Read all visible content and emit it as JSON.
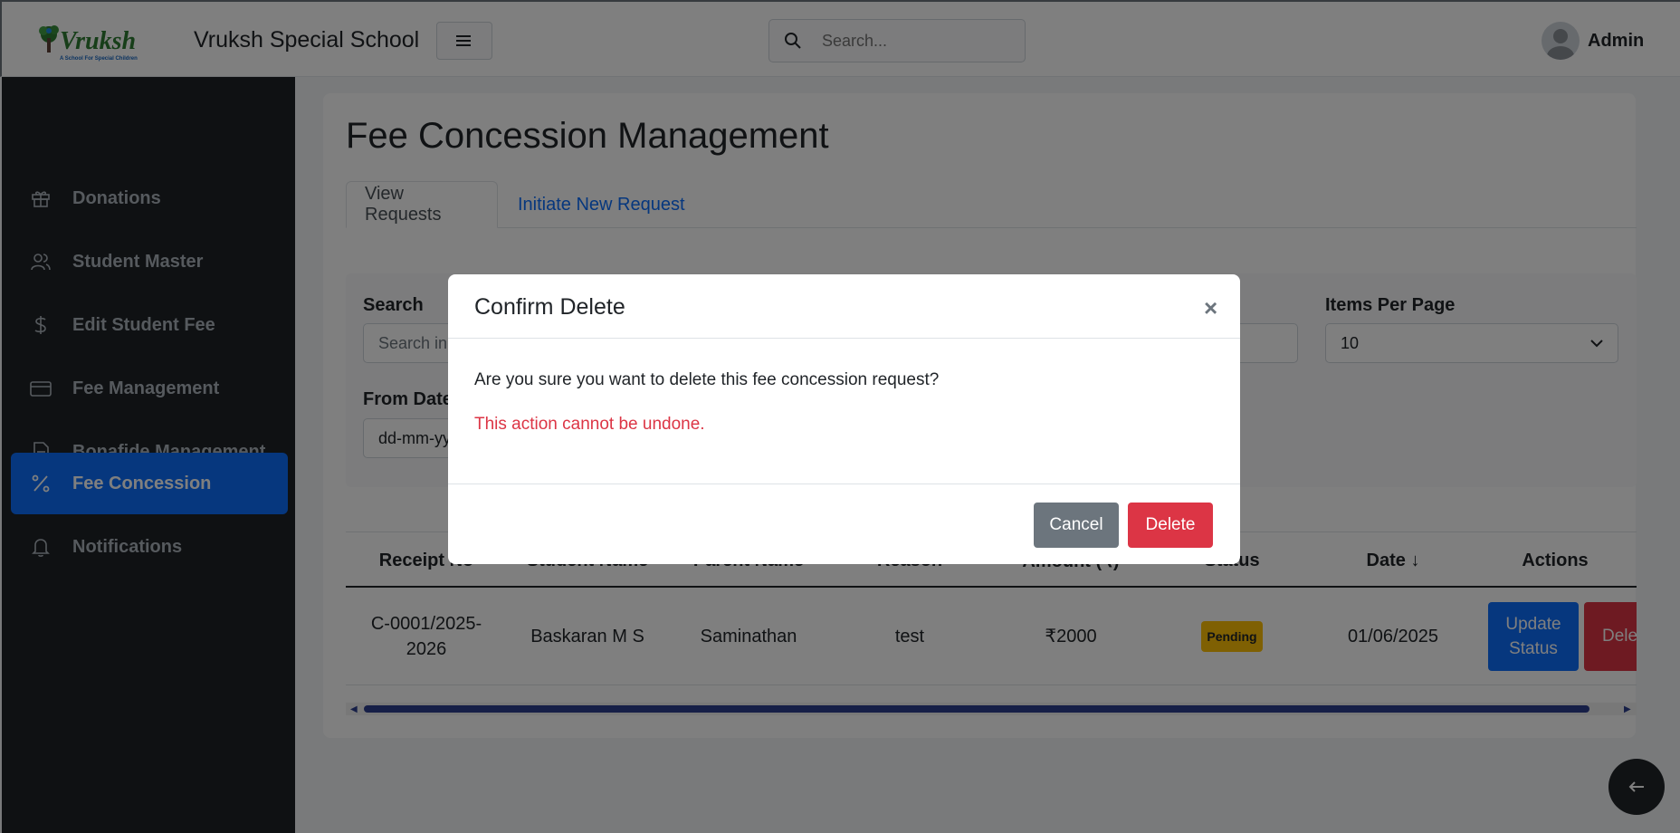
{
  "header": {
    "brand": "Vruksh Special School",
    "logo_text": "Vruksh",
    "logo_tagline": "A School For Special Children",
    "search_placeholder": "Search...",
    "user": "Admin"
  },
  "sidebar": {
    "items": [
      {
        "label": "Donations",
        "icon": "gift-icon"
      },
      {
        "label": "Student Master",
        "icon": "users-icon"
      },
      {
        "label": "Edit Student Fee",
        "icon": "dollar-icon"
      },
      {
        "label": "Fee Management",
        "icon": "credit-card-icon"
      },
      {
        "label": "Bonafide Management",
        "icon": "document-icon"
      },
      {
        "label": "Fee Concession",
        "icon": "percent-icon",
        "active": true
      },
      {
        "label": "Notifications",
        "icon": "bell-icon"
      }
    ]
  },
  "main": {
    "title": "Fee Concession Management",
    "tabs": [
      {
        "label": "View Requests",
        "active": true
      },
      {
        "label": "Initiate New Request"
      }
    ],
    "filters": {
      "search_label": "Search",
      "search_placeholder": "Search in",
      "items_per_page_label": "Items Per Page",
      "items_per_page_value": "10",
      "from_date_label": "From Date",
      "from_date_placeholder": "dd-mm-yy"
    },
    "table": {
      "headers": [
        "Receipt No",
        "Student Name",
        "Parent Name",
        "Reason",
        "Amount (₹)",
        "Status",
        "Date ↓",
        "Actions"
      ],
      "rows": [
        {
          "receipt_no": "C-0001/2025-2026",
          "receipt_line1": "C-0001/2025-",
          "receipt_line2": "2026",
          "student": "Baskaran M S",
          "parent": "Saminathan",
          "reason": "test",
          "amount": "₹2000",
          "status": "Pending",
          "date": "01/06/2025",
          "update_label_1": "Update",
          "update_label_2": "Status",
          "delete_label": "Delete"
        }
      ]
    }
  },
  "modal": {
    "title": "Confirm Delete",
    "close": "×",
    "message": "Are you sure you want to delete this fee concession request?",
    "warning": "This action cannot be undone.",
    "cancel_label": "Cancel",
    "delete_label": "Delete"
  },
  "colors": {
    "primary": "#0d6efd",
    "danger": "#dc3545",
    "secondary": "#6c757d",
    "warning": "#ffc107",
    "sidebar_bg": "#1e2226"
  }
}
